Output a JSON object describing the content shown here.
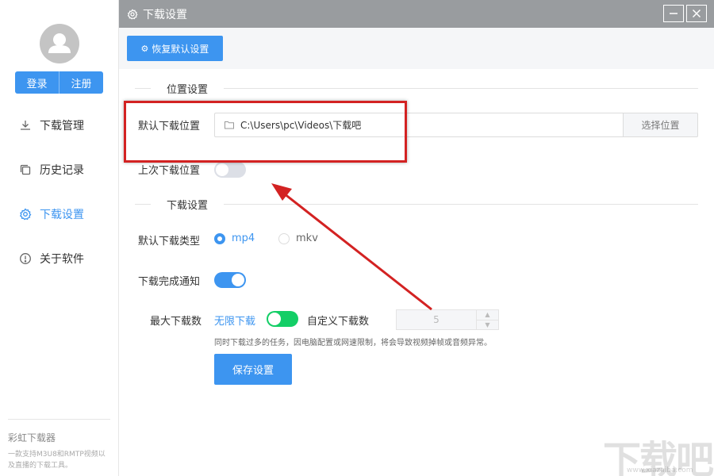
{
  "sidebar": {
    "login_label": "登录",
    "register_label": "注册",
    "items": [
      {
        "label": "下载管理",
        "icon": "download-icon"
      },
      {
        "label": "历史记录",
        "icon": "history-icon"
      },
      {
        "label": "下载设置",
        "icon": "gear-icon",
        "active": true
      },
      {
        "label": "关于软件",
        "icon": "info-icon"
      }
    ],
    "footer": {
      "title": "彩虹下载器",
      "subtitle": "一款支持M3U8和RMTP视频以及直播的下载工具。"
    }
  },
  "window": {
    "title": "下载设置"
  },
  "toolbar": {
    "reset_label": "恢复默认设置"
  },
  "location_section": {
    "title": "位置设置",
    "default_path_label": "默认下载位置",
    "default_path_value": "C:\\Users\\pc\\Videos\\下载吧",
    "choose_label": "选择位置",
    "last_location_label": "上次下载位置",
    "last_location_enabled": false
  },
  "download_section": {
    "title": "下载设置",
    "type_label": "默认下载类型",
    "type_options": [
      "mp4",
      "mkv"
    ],
    "type_selected": "mp4",
    "notify_label": "下载完成通知",
    "notify_enabled": true,
    "max_label": "最大下载数",
    "unlimited_label": "无限下载",
    "custom_label": "自定义下载数",
    "custom_value": "5",
    "hint": "同时下载过多的任务，因电脑配置或网速限制，将会导致视频掉帧或音频异常。",
    "save_label": "保存设置"
  },
  "watermark": {
    "text": "下载吧",
    "url": "www.xiazaiba.com"
  },
  "colors": {
    "accent": "#3d95f0",
    "titlebar": "#999c9f",
    "annotation": "#d32222",
    "toggle_green": "#13ce66"
  }
}
